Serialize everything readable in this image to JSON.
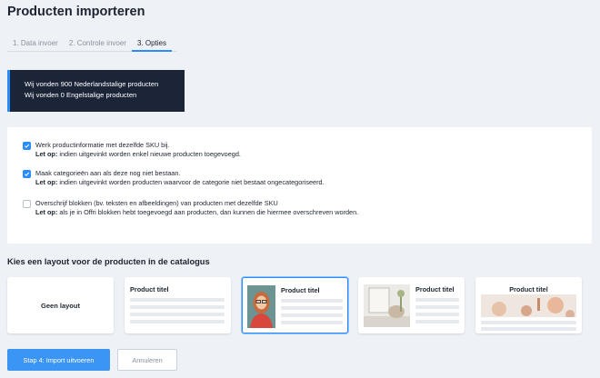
{
  "header": {
    "title": "Producten importeren"
  },
  "tabs": [
    {
      "label": "1. Data invoer",
      "active": false
    },
    {
      "label": "2. Controle invoer",
      "active": false
    },
    {
      "label": "3. Opties",
      "active": true
    }
  ],
  "info": {
    "line1": "Wij vonden 900 Nederlandstalige producten",
    "line2": "Wij vonden 0 Engelstalige producten"
  },
  "options": [
    {
      "checked": true,
      "label": "Werk productinformatie met dezelfde SKU bij.",
      "note_prefix": "Let op:",
      "note": " indien uitgevinkt worden enkel nieuwe producten toegevoegd."
    },
    {
      "checked": true,
      "label": "Maak categorieën aan als deze nog niet bestaan.",
      "note_prefix": "Let op:",
      "note": " indien uitgevinkt worden producten waarvoor de categorie niet bestaat ongecategoriseerd."
    },
    {
      "checked": false,
      "label": "Overschrijf blokken (bv. teksten en afbeeldingen) van producten met dezelfde SKU",
      "note_prefix": "Let op:",
      "note": " als je in Offri blokken hebt toegevoegd aan producten, dan kunnen die hiermee overschreven worden."
    }
  ],
  "layout_section": {
    "heading": "Kies een layout voor de producten in de catalogus",
    "cards": [
      {
        "label": "Geen layout",
        "selected": false
      },
      {
        "label": "Product titel",
        "selected": false
      },
      {
        "label": "Product titel",
        "selected": true
      },
      {
        "label": "Product titel",
        "selected": false
      },
      {
        "label": "Product titel",
        "selected": false
      }
    ]
  },
  "actions": {
    "primary_label": "Stap 4: Import uitvoeren",
    "secondary_label": "Annuleren"
  },
  "colors": {
    "accent": "#2a8cff",
    "info_bg": "#1c2538",
    "primary_button": "#3b95f5"
  }
}
